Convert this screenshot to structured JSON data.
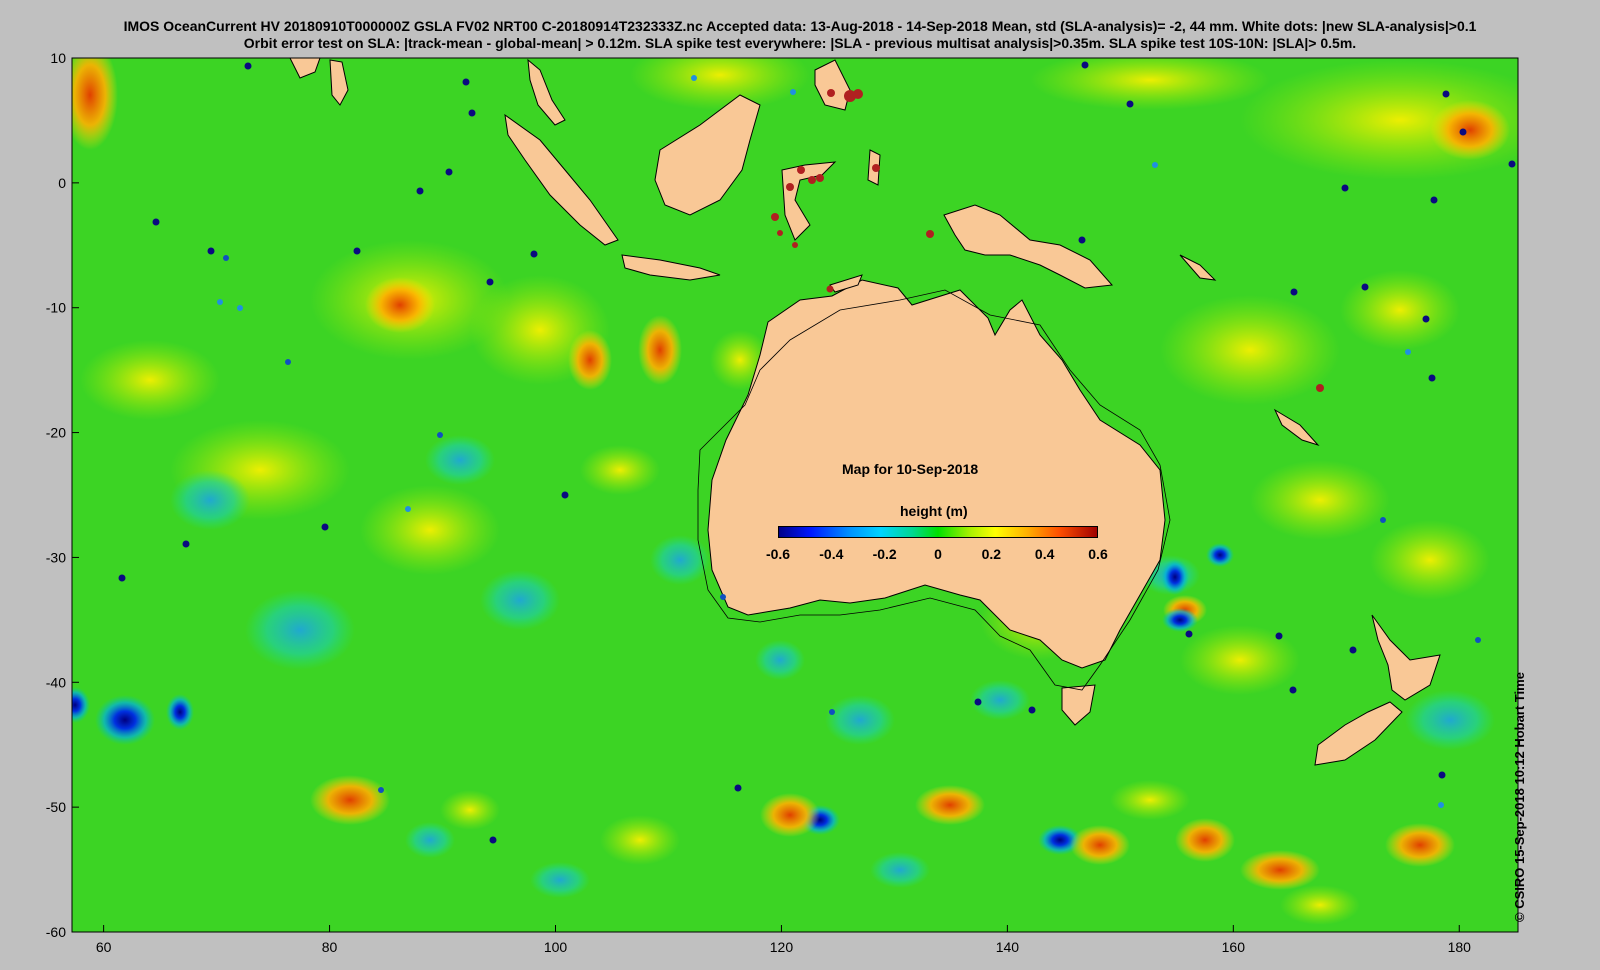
{
  "header": {
    "line1": "IMOS OceanCurrent HV 20180910T000000Z GSLA FV02 NRT00 C-20180914T232333Z.nc  Accepted data: 13-Aug-2018 - 14-Sep-2018 Mean, std (SLA-analysis)= -2, 44 mm. White dots: |new SLA-analysis|>0.1",
    "line2": "Orbit error test on SLA: |track-mean  - global-mean| > 0.12m.  SLA spike test everywhere: |SLA - previous multisat analysis|>0.35m. SLA spike test 10S-10N: |SLA|> 0.5m."
  },
  "map": {
    "title": "Map for 10-Sep-2018",
    "lon_ticks": [
      "60",
      "80",
      "100",
      "120",
      "140",
      "160",
      "180"
    ],
    "lat_ticks": [
      "10",
      "0",
      "-10",
      "-20",
      "-30",
      "-40",
      "-50",
      "-60"
    ],
    "lon_range": [
      57.2,
      185.2
    ],
    "lat_range": [
      -60,
      10
    ],
    "ocean_color": "#3cd424",
    "land_color": "#f9c896"
  },
  "colorbar": {
    "title": "height (m)",
    "ticks": [
      "-0.6",
      "-0.4",
      "-0.2",
      "0",
      "0.2",
      "0.4",
      "0.6"
    ],
    "range": [
      -0.6,
      0.6
    ]
  },
  "credit": "© CSIRO 15-Sep-2018 10:12 Hobart Time"
}
